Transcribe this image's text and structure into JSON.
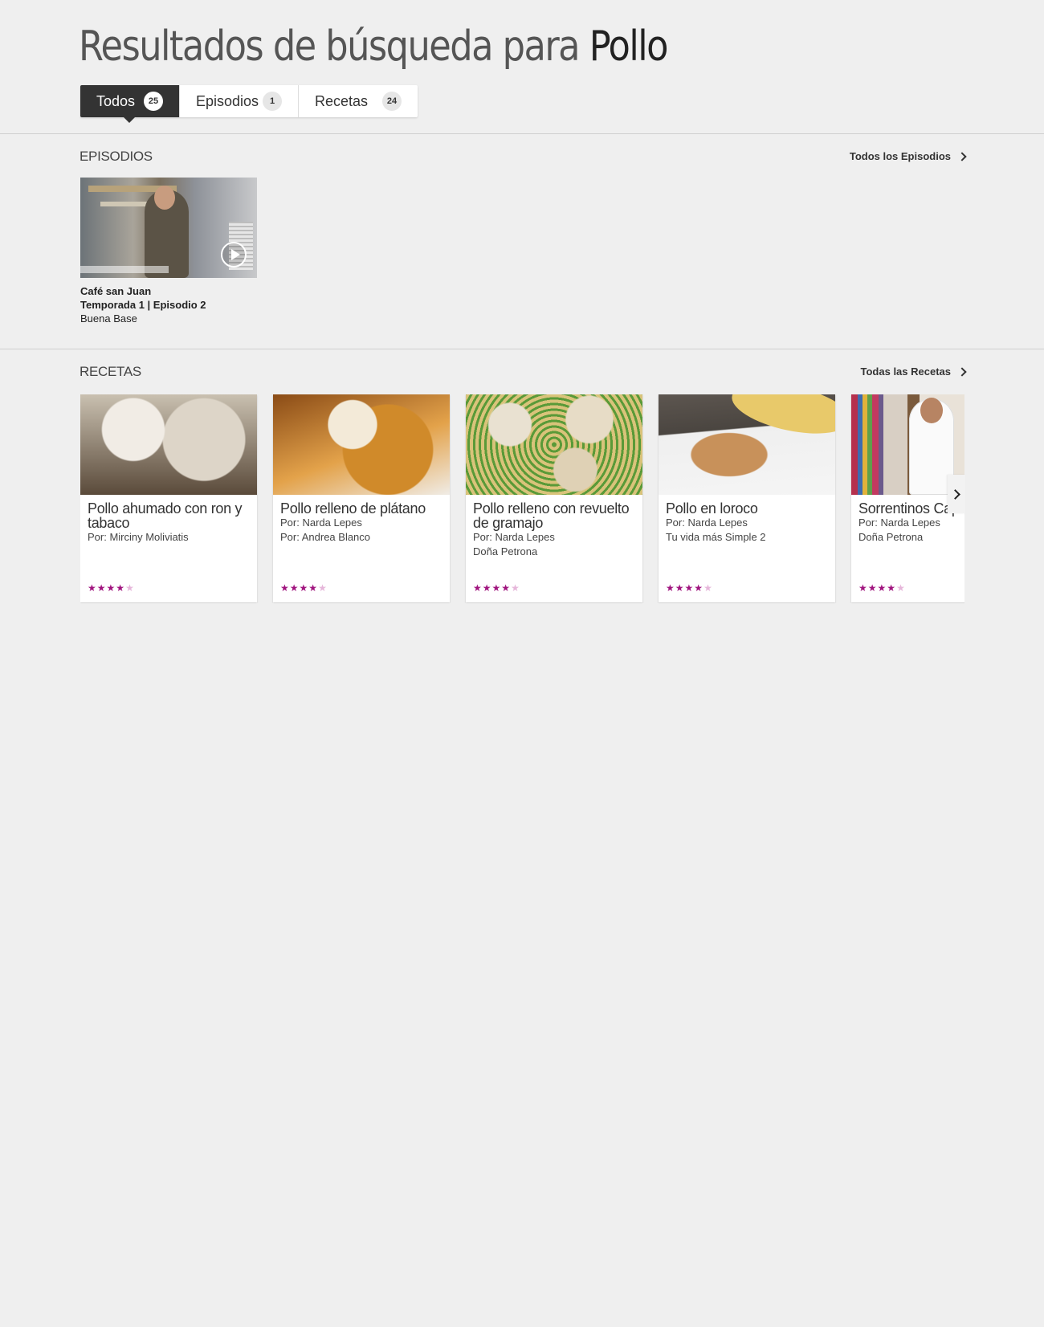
{
  "header": {
    "title_prefix": "Resultados de búsqueda para ",
    "query": "Pollo"
  },
  "tabs": [
    {
      "label": "Todos",
      "count": "25",
      "active": true
    },
    {
      "label": "Episodios",
      "count": "1",
      "active": false
    },
    {
      "label": "Recetas",
      "count": "24",
      "active": false
    }
  ],
  "episodes": {
    "section_title": "EPISODIOS",
    "see_all": "Todos los Episodios",
    "items": [
      {
        "title": "Café san Juan",
        "subtitle": "Temporada 1 | Episodio 2",
        "show": "Buena Base"
      }
    ]
  },
  "recipes": {
    "section_title": "RECETAS",
    "see_all": "Todas las Recetas",
    "items": [
      {
        "title": "Pollo ahumado con ron y tabaco",
        "author": "Por: Mirciny Moliviatis",
        "show": "",
        "rating": 4,
        "max_rating": 5
      },
      {
        "title": "Pollo relleno de plátano",
        "author": "Por: Narda Lepes",
        "show": "Por: Andrea Blanco",
        "rating": 4,
        "max_rating": 5
      },
      {
        "title": "Pollo relleno con revuelto de gramajo",
        "author": "Por: Narda Lepes",
        "show": "Doña Petrona",
        "rating": 4,
        "max_rating": 5
      },
      {
        "title": "Pollo en loroco",
        "author": "Por: Narda Lepes",
        "show": "Tu vida más Simple 2",
        "rating": 4,
        "max_rating": 5
      },
      {
        "title": "Sorrentinos Capresse",
        "author": "Por: Narda Lepes",
        "show": "Doña Petrona",
        "rating": 4,
        "max_rating": 5
      }
    ]
  },
  "colors": {
    "star_on": "#a0137e",
    "star_off": "#e6b6da",
    "active_tab": "#333333",
    "background": "#efefef"
  }
}
